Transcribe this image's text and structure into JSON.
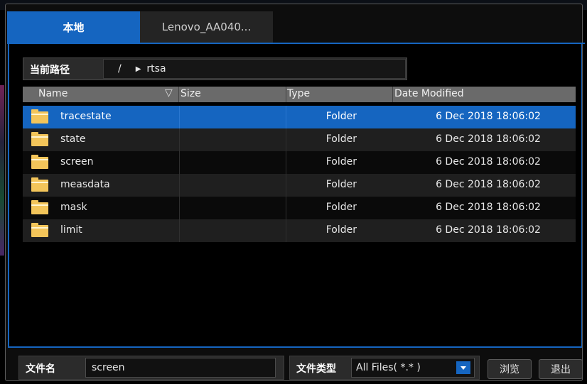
{
  "tabs": [
    {
      "label": "本地",
      "active": true
    },
    {
      "label": "Lenovo_AA040...",
      "active": false
    }
  ],
  "path": {
    "label": "当前路径",
    "separator": "/",
    "current_dir": "rtsa"
  },
  "table": {
    "columns": [
      "Name",
      "Size",
      "Type",
      "Date Modified"
    ],
    "sort_column": "Name",
    "rows": [
      {
        "name": "tracestate",
        "size": "",
        "type": "Folder",
        "date": "6 Dec 2018 18:06:02",
        "selected": true
      },
      {
        "name": "state",
        "size": "",
        "type": "Folder",
        "date": "6 Dec 2018 18:06:02",
        "selected": false
      },
      {
        "name": "screen",
        "size": "",
        "type": "Folder",
        "date": "6 Dec 2018 18:06:02",
        "selected": false
      },
      {
        "name": "measdata",
        "size": "",
        "type": "Folder",
        "date": "6 Dec 2018 18:06:02",
        "selected": false
      },
      {
        "name": "mask",
        "size": "",
        "type": "Folder",
        "date": "6 Dec 2018 18:06:02",
        "selected": false
      },
      {
        "name": "limit",
        "size": "",
        "type": "Folder",
        "date": "6 Dec 2018 18:06:02",
        "selected": false
      }
    ]
  },
  "footer": {
    "filename_label": "文件名",
    "filename_value": "screen",
    "filetype_label": "文件类型",
    "filetype_value": "All Files( *.* )",
    "browse_label": "浏览",
    "exit_label": "退出"
  },
  "colors": {
    "accent": "#1565c0",
    "folder": "#f3c55a",
    "header_bg": "#6a6a6a"
  }
}
